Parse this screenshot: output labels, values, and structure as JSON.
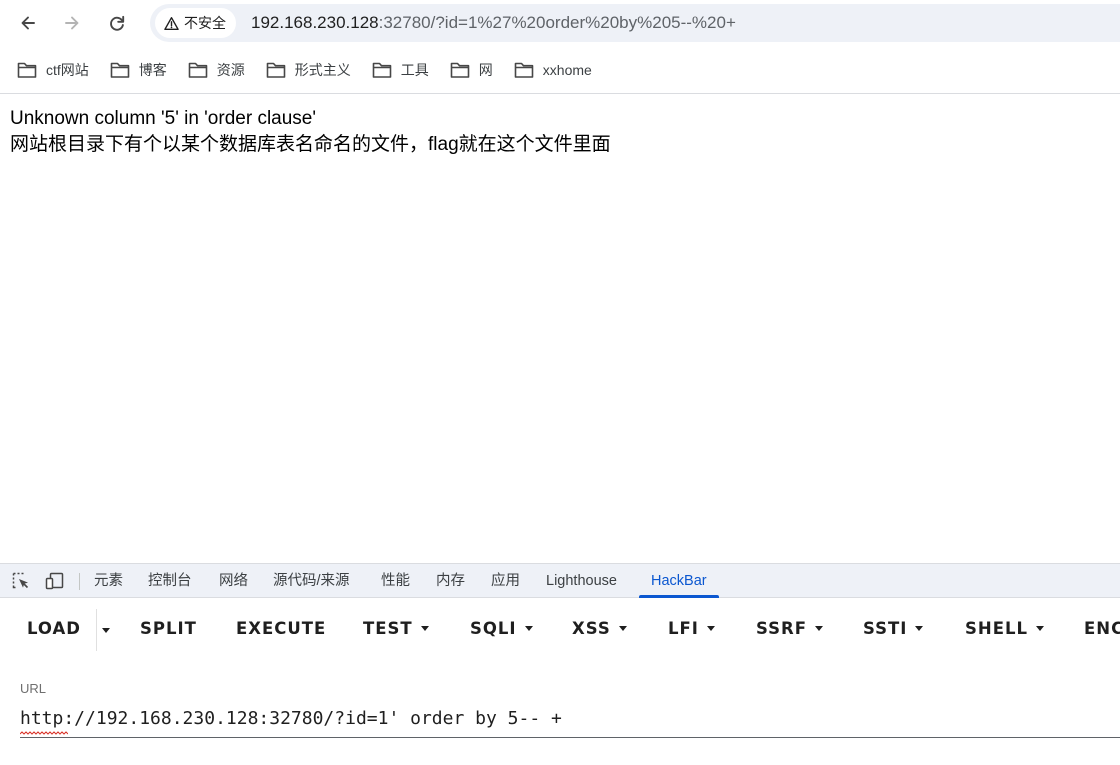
{
  "browser": {
    "security_label": "不安全",
    "url_host": "192.168.230.128",
    "url_rest": ":32780/?id=1%27%20order%20by%205--%20+"
  },
  "bookmarks": [
    {
      "label": "ctf网站",
      "icon": "folder-icon"
    },
    {
      "label": "博客",
      "icon": "folder-icon"
    },
    {
      "label": "资源",
      "icon": "folder-icon"
    },
    {
      "label": "形式主义",
      "icon": "folder-icon"
    },
    {
      "label": "工具",
      "icon": "folder-icon"
    },
    {
      "label": "网",
      "icon": "folder-icon"
    },
    {
      "label": "xxhome",
      "icon": "folder-icon"
    }
  ],
  "page": {
    "line1": "Unknown column '5' in 'order clause'",
    "line2": "网站根目录下有个以某个数据库表名命名的文件，flag就在这个文件里面"
  },
  "devtools": {
    "tabs": [
      "元素",
      "控制台",
      "网络",
      "源代码/来源",
      "性能",
      "内存",
      "应用",
      "Lighthouse",
      "HackBar"
    ],
    "active_tab": "HackBar",
    "accent": "#0b57d0"
  },
  "hackbar": {
    "buttons": [
      "LOAD",
      "SPLIT",
      "EXECUTE",
      "TEST",
      "SQLI",
      "XSS",
      "LFI",
      "SSRF",
      "SSTI",
      "SHELL",
      "ENC"
    ],
    "url_label": "URL",
    "url_value": "http://192.168.230.128:32780/?id=1' order by 5-- +"
  }
}
